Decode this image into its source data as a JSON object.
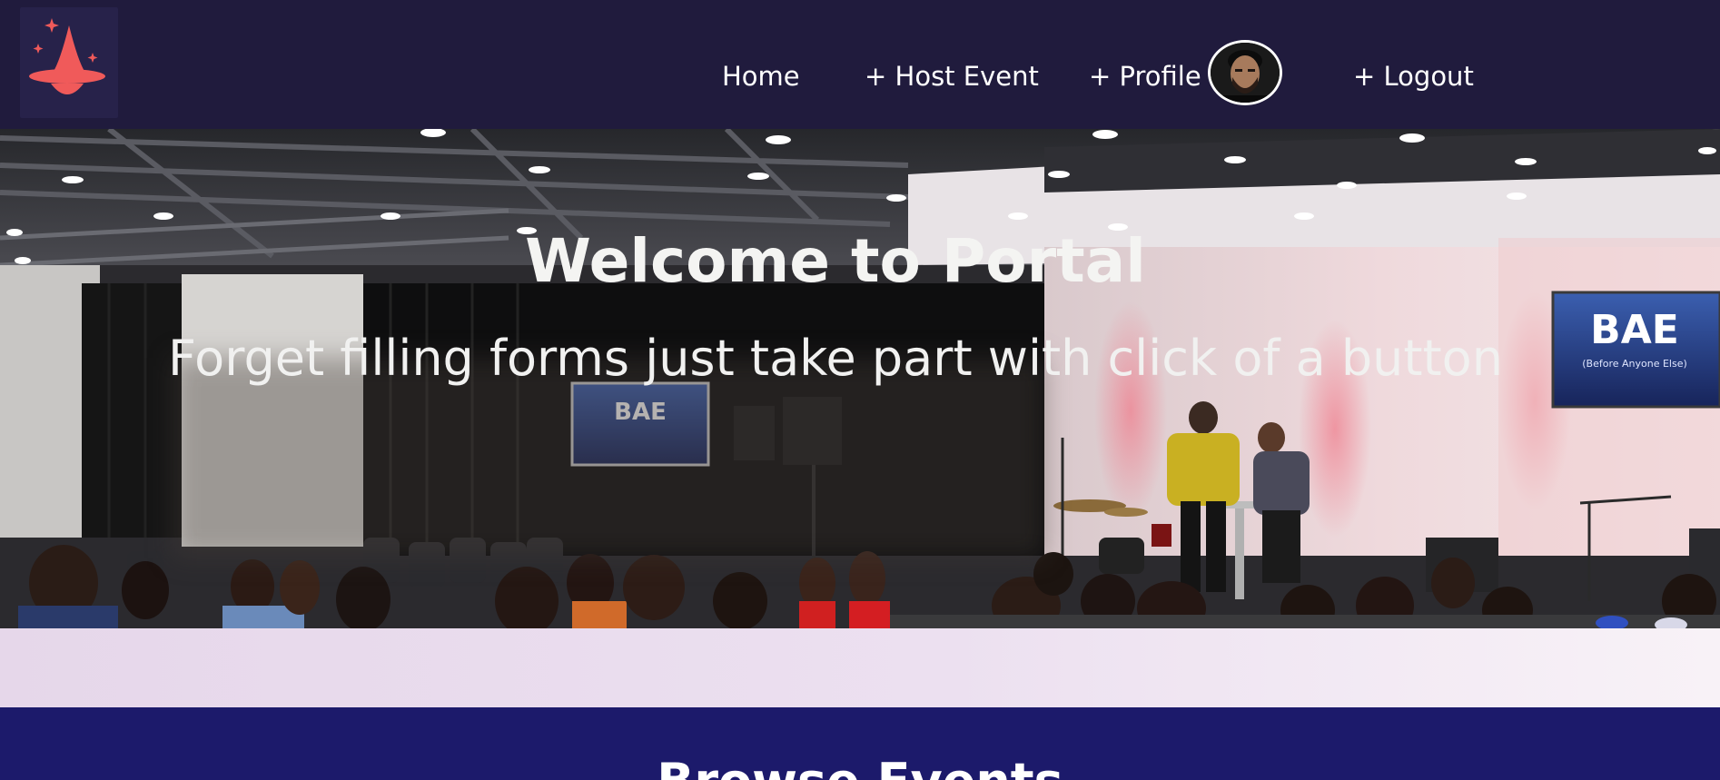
{
  "navbar": {
    "logo_icon": "wizard-hat-icon",
    "links": {
      "home": "Home",
      "host_event": "+ Host Event",
      "profile": "+ Profile",
      "logout": "+ Logout"
    },
    "avatar_icon": "user-avatar"
  },
  "hero": {
    "title": "Welcome to Portal",
    "subtitle": "Forget filling forms just take part with click of a button",
    "screen_text": "BAE",
    "screen_subtext": "(Before Anyone Else)"
  },
  "browse": {
    "title": "Browse Events"
  },
  "colors": {
    "navbar_bg": "#201b3d",
    "logo_accent": "#f05a5a",
    "band": "#ece0f0",
    "browse_bg": "#1c1a6b"
  }
}
